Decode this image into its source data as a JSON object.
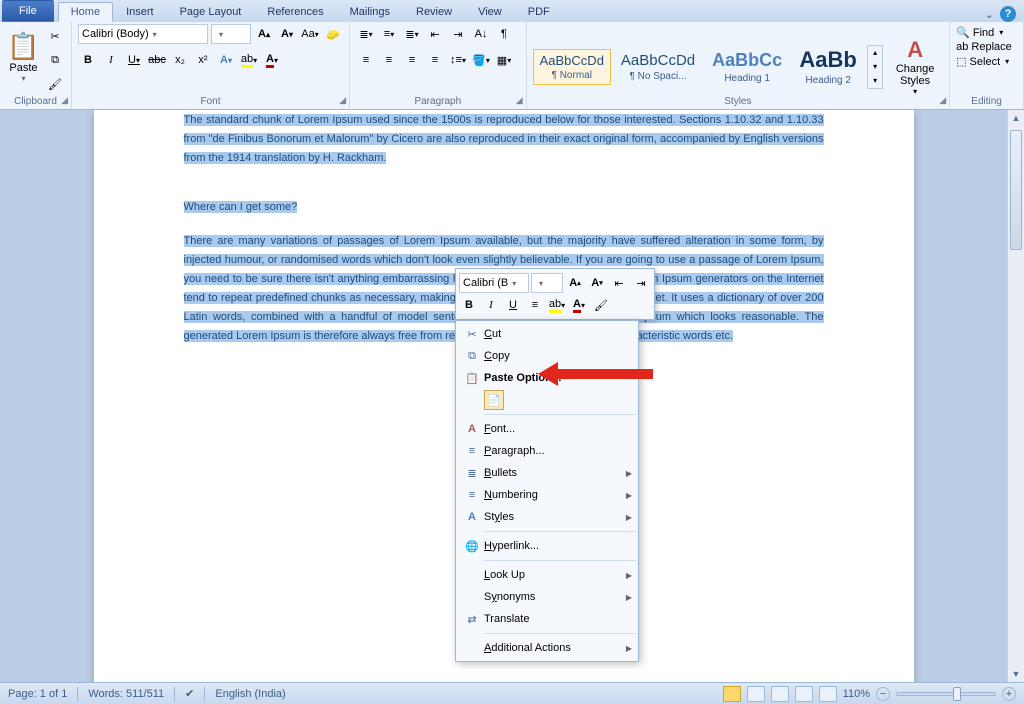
{
  "tabs": {
    "file": "File",
    "home": "Home",
    "insert": "Insert",
    "pagelayout": "Page Layout",
    "references": "References",
    "mailings": "Mailings",
    "review": "Review",
    "view": "View",
    "pdf": "PDF"
  },
  "clipboard": {
    "paste": "Paste",
    "label": "Clipboard"
  },
  "font": {
    "family": "Calibri (Body)",
    "size": "",
    "label": "Font",
    "bold": "B",
    "italic": "I",
    "underline": "U",
    "strike": "abc",
    "sub": "x₂",
    "sup": "x²"
  },
  "paragraph": {
    "label": "Paragraph"
  },
  "styles": {
    "label": "Styles",
    "change": "Change Styles",
    "items": [
      {
        "sample": "AaBbCcDd",
        "name": "¶ Normal"
      },
      {
        "sample": "AaBbCcDd",
        "name": "¶ No Spaci..."
      },
      {
        "sample": "AaBbCc",
        "name": "Heading 1"
      },
      {
        "sample": "AaBb",
        "name": "Heading 2"
      }
    ]
  },
  "editing": {
    "find": "Find",
    "replace": "Replace",
    "select": "Select",
    "label": "Editing"
  },
  "document": {
    "p1": "The standard chunk of Lorem Ipsum used since the 1500s is reproduced below for those interested. Sections 1.10.32 and 1.10.33 from \"de Finibus Bonorum et Malorum\" by Cicero are also reproduced in their exact original form, accompanied by English versions from the 1914 translation by H. Rackham.",
    "h1": "Where can I get some?",
    "p2": "There are many variations of passages of Lorem Ipsum available, but the majority have suffered alteration in some form, by injected humour, or randomised words which don't look even slightly believable. If you are going to use a passage of Lorem Ipsum, you need to be sure there isn't anything embarrassing hidden in the middle of text. All the Lorem Ipsum generators on the Internet tend to repeat predefined chunks as necessary, making this the first true generator on the Internet. It uses a dictionary of over 200 Latin words, combined with a handful of model sentence structures, to generate Lorem Ipsum which looks reasonable. The generated Lorem Ipsum is therefore always free from repetition, injected humour, or non-characteristic words etc."
  },
  "mini": {
    "font": "Calibri (B",
    "size": "",
    "b": "B",
    "i": "I",
    "u": "U"
  },
  "ctx": {
    "cut": "Cut",
    "copy": "Copy",
    "pasteopts": "Paste Options:",
    "font": "Font...",
    "paragraph": "Paragraph...",
    "bullets": "Bullets",
    "numbering": "Numbering",
    "styles": "Styles",
    "hyperlink": "Hyperlink...",
    "lookup": "Look Up",
    "synonyms": "Synonyms",
    "translate": "Translate",
    "additional": "Additional Actions"
  },
  "status": {
    "page": "Page: 1 of 1",
    "words": "Words: 511/511",
    "lang": "English (India)",
    "zoom": "110%"
  }
}
